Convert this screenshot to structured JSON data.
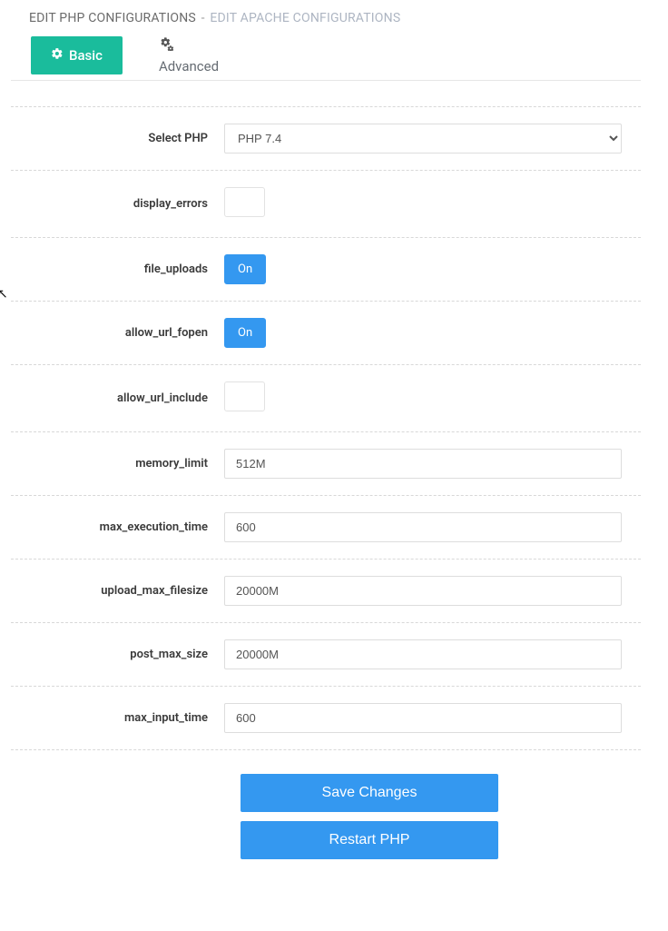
{
  "breadcrumb": {
    "active": "EDIT PHP CONFIGURATIONS",
    "sep": "-",
    "inactive": "EDIT APACHE CONFIGURATIONS"
  },
  "tabs": {
    "basic": "Basic",
    "advanced": "Advanced"
  },
  "fields": {
    "select_php": {
      "label": "Select PHP",
      "value": "PHP 7.4"
    },
    "display_errors": {
      "label": "display_errors",
      "state": "off",
      "text": ""
    },
    "file_uploads": {
      "label": "file_uploads",
      "state": "on",
      "text": "On"
    },
    "allow_url_fopen": {
      "label": "allow_url_fopen",
      "state": "on",
      "text": "On"
    },
    "allow_url_include": {
      "label": "allow_url_include",
      "state": "off",
      "text": ""
    },
    "memory_limit": {
      "label": "memory_limit",
      "value": "512M"
    },
    "max_execution_time": {
      "label": "max_execution_time",
      "value": "600"
    },
    "upload_max_filesize": {
      "label": "upload_max_filesize",
      "value": "20000M"
    },
    "post_max_size": {
      "label": "post_max_size",
      "value": "20000M"
    },
    "max_input_time": {
      "label": "max_input_time",
      "value": "600"
    }
  },
  "buttons": {
    "save": "Save Changes",
    "restart": "Restart PHP"
  }
}
